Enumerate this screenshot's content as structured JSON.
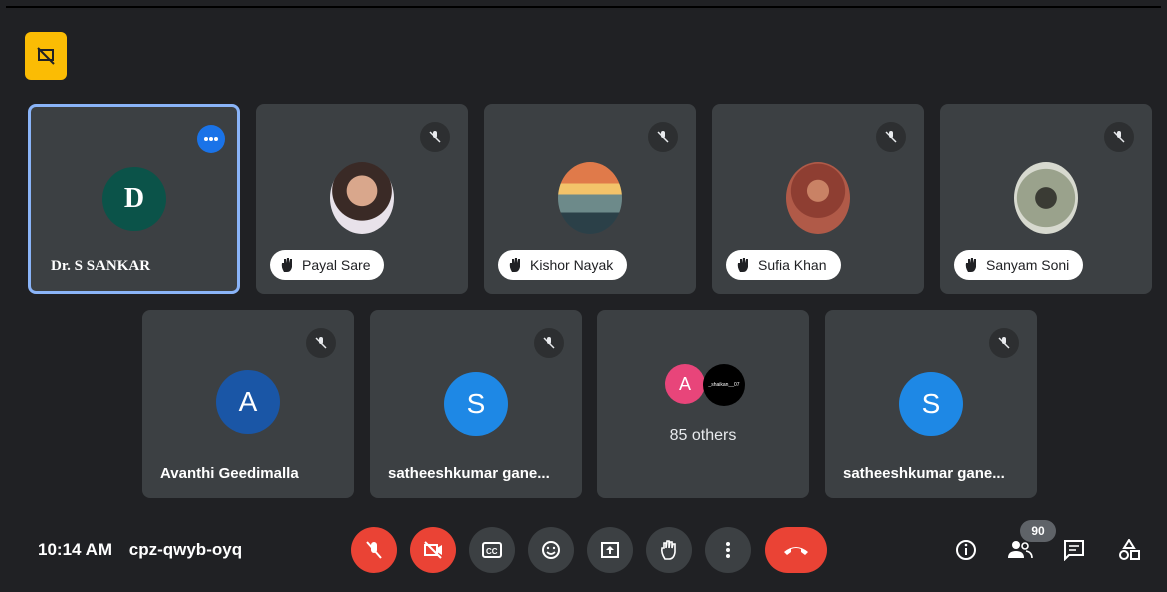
{
  "tiles_row1": [
    {
      "name": "Dr. S SANKAR",
      "avatar_letter": "D",
      "avatar_color": "#0b5349"
    },
    {
      "name": "Payal Sare"
    },
    {
      "name": "Kishor Nayak"
    },
    {
      "name": "Sufia Khan"
    },
    {
      "name": "Sanyam Soni"
    }
  ],
  "tiles_row2": [
    {
      "name": "Avanthi Geedimalla",
      "avatar_letter": "A",
      "avatar_color": "#1a56a6"
    },
    {
      "name": "satheeshkumar gane...",
      "avatar_letter": "S",
      "avatar_color": "#1e88e5"
    },
    {
      "others_label": "85 others",
      "avatar1_letter": "A",
      "avatar1_color": "#e8457a",
      "avatar2_text": "_shaikan__07"
    },
    {
      "name": "satheeshkumar gane...",
      "avatar_letter": "S",
      "avatar_color": "#1e88e5"
    }
  ],
  "bottom": {
    "time": "10:14 AM",
    "meeting_code": "cpz-qwyb-oyq",
    "participant_count": "90"
  },
  "colors": {
    "danger": "#ea4335",
    "accent": "#8ab4f8",
    "badge": "#fbbc04"
  }
}
